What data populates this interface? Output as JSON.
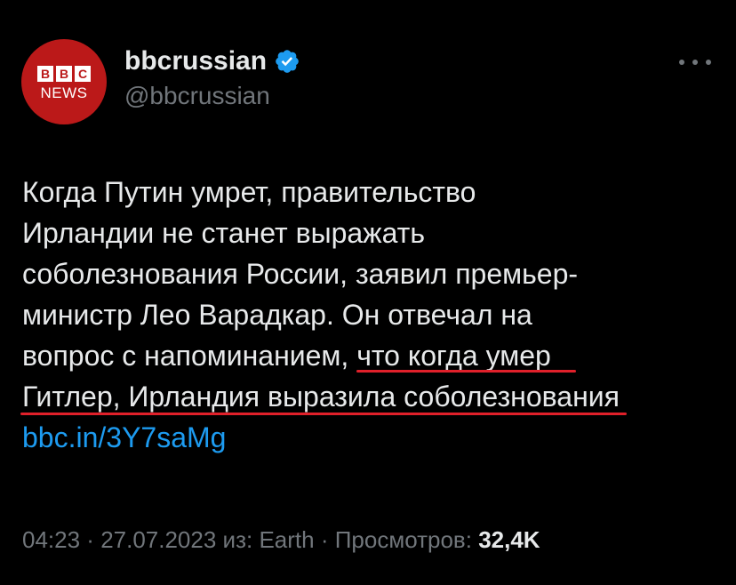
{
  "author": {
    "display_name": "bbcrussian",
    "handle": "@bbcrussian",
    "avatar": {
      "blocks": [
        "B",
        "B",
        "C"
      ],
      "news_word": "NEWS",
      "background_color": "#bb1919"
    },
    "verified": true
  },
  "tweet": {
    "lines": [
      "Когда Путин умрет, правительство",
      "Ирландии не станет выражать",
      "соболезнования России, заявил премьер-",
      "министр Лео Варадкар. Он отвечал на"
    ],
    "line5_prefix": "вопрос с напоминанием, ",
    "line5_underlined": "что когда умер",
    "line6_underlined": "Гитлер, Ирландия выразила соболезнования",
    "link": "bbc.in/3Y7saMg"
  },
  "meta": {
    "time": "04:23",
    "separator1": " · ",
    "date": "27.07.2023",
    "source_prefix": " из: ",
    "source": "Earth",
    "separator2": " · ",
    "views_label": "Просмотров: ",
    "views_count": "32,4K"
  },
  "colors": {
    "background": "#000000",
    "text": "#e7e9ea",
    "muted": "#71767b",
    "link": "#1d9bf0",
    "verified": "#1d9bf0",
    "underline": "#e0202a"
  },
  "icons": {
    "verified": "verified-badge-icon",
    "more": "more-horizontal-icon"
  }
}
